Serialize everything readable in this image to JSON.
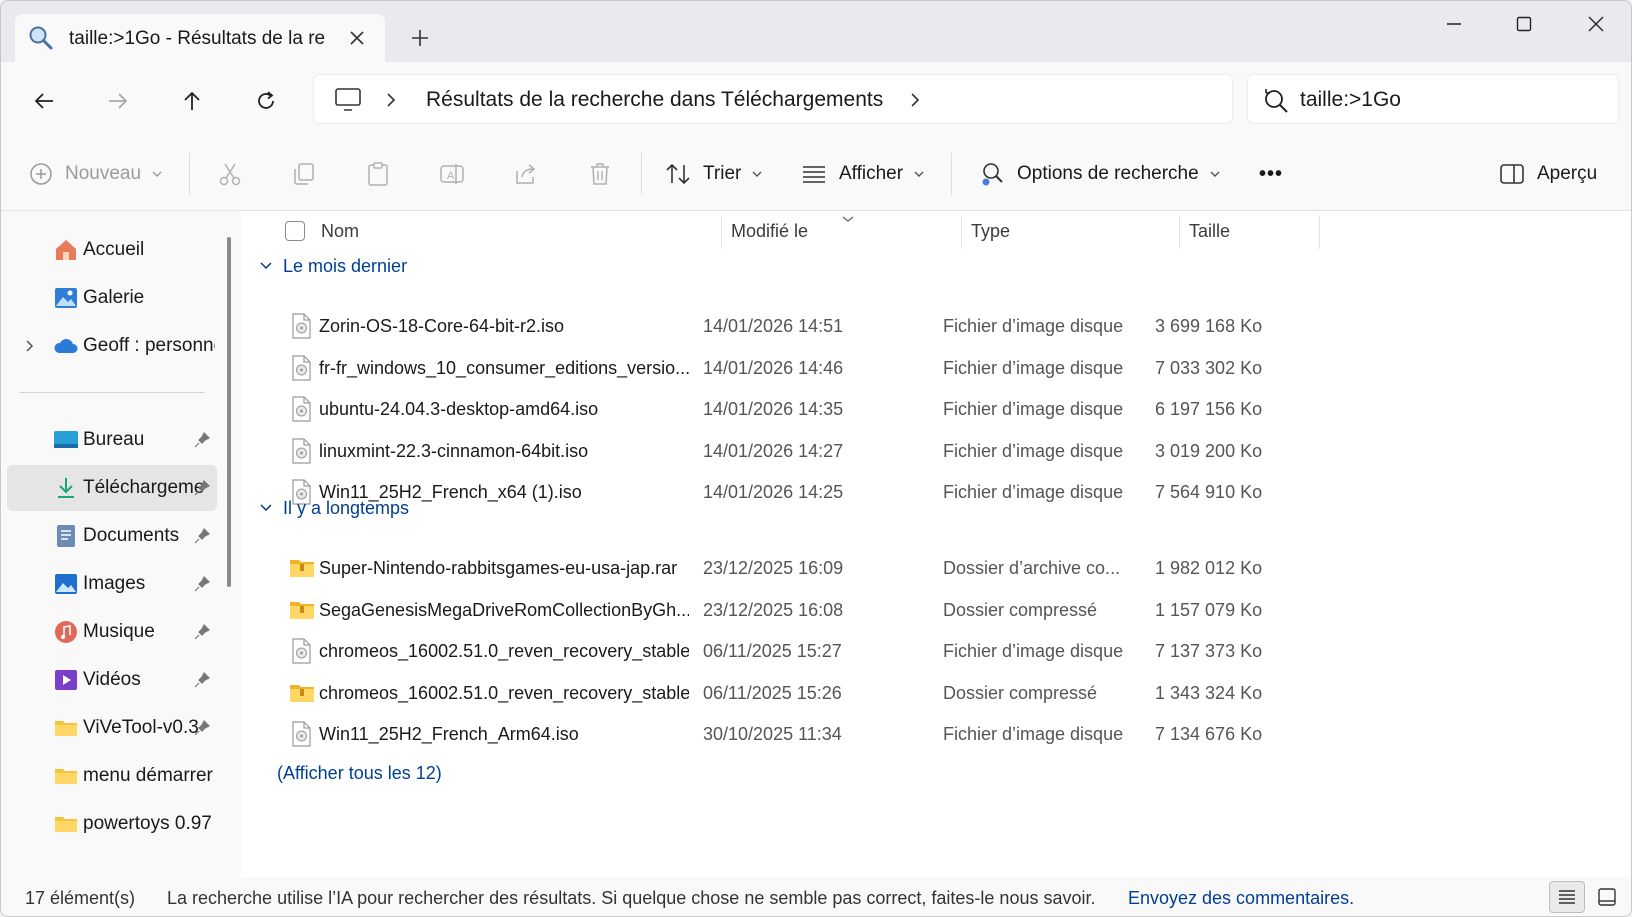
{
  "tab": {
    "title": "taille:>1Go - Résultats de la re"
  },
  "address": {
    "path": "Résultats de la recherche dans Téléchargements"
  },
  "search": {
    "query": "taille:>1Go"
  },
  "toolbar": {
    "new_label": "Nouveau",
    "sort_label": "Trier",
    "view_label": "Afficher",
    "search_options_label": "Options de recherche",
    "more_label": "•••",
    "preview_label": "Aperçu"
  },
  "sidebar": {
    "items": [
      {
        "label": "Accueil",
        "icon": "home-icon"
      },
      {
        "label": "Galerie",
        "icon": "gallery-icon"
      },
      {
        "label": "Geoff : personne",
        "icon": "cloud-icon"
      },
      {
        "label": "Bureau",
        "icon": "desktop-icon"
      },
      {
        "label": "Téléchargeme",
        "icon": "download-icon"
      },
      {
        "label": "Documents",
        "icon": "documents-icon"
      },
      {
        "label": "Images",
        "icon": "images-icon"
      },
      {
        "label": "Musique",
        "icon": "music-icon"
      },
      {
        "label": "Vidéos",
        "icon": "videos-icon"
      },
      {
        "label": "ViVeTool-v0.3",
        "icon": "folder-icon"
      },
      {
        "label": "menu démarrer",
        "icon": "folder-icon"
      },
      {
        "label": "powertoys 0.97",
        "icon": "folder-icon"
      }
    ]
  },
  "columns": {
    "name": "Nom",
    "modified": "Modifié le",
    "type": "Type",
    "size": "Taille"
  },
  "groups": [
    {
      "label": "Le mois dernier",
      "files": [
        {
          "name": "Zorin-OS-18-Core-64-bit-r2.iso",
          "date": "14/01/2026 14:51",
          "type": "Fichier d’image disque",
          "size": "3 699 168 Ko",
          "icon": "disc-image-icon"
        },
        {
          "name": "fr-fr_windows_10_consumer_editions_versio...",
          "date": "14/01/2026 14:46",
          "type": "Fichier d’image disque",
          "size": "7 033 302 Ko",
          "icon": "disc-image-icon"
        },
        {
          "name": "ubuntu-24.04.3-desktop-amd64.iso",
          "date": "14/01/2026 14:35",
          "type": "Fichier d’image disque",
          "size": "6 197 156 Ko",
          "icon": "disc-image-icon"
        },
        {
          "name": "linuxmint-22.3-cinnamon-64bit.iso",
          "date": "14/01/2026 14:27",
          "type": "Fichier d’image disque",
          "size": "3 019 200 Ko",
          "icon": "disc-image-icon"
        },
        {
          "name": "Win11_25H2_French_x64 (1).iso",
          "date": "14/01/2026 14:25",
          "type": "Fichier d’image disque",
          "size": "7 564 910 Ko",
          "icon": "disc-image-icon"
        }
      ]
    },
    {
      "label": "Il y a longtemps",
      "files": [
        {
          "name": "Super-Nintendo-rabbitsgames-eu-usa-jap.rar",
          "date": "23/12/2025 16:09",
          "type": "Dossier d’archive co...",
          "size": "1 982 012 Ko",
          "icon": "archive-folder-icon"
        },
        {
          "name": "SegaGenesisMegaDriveRomCollectionByGh...",
          "date": "23/12/2025 16:08",
          "type": "Dossier compressé",
          "size": "1 157 079 Ko",
          "icon": "archive-folder-icon"
        },
        {
          "name": "chromeos_16002.51.0_reven_recovery_stable...",
          "date": "06/11/2025 15:27",
          "type": "Fichier d’image disque",
          "size": "7 137 373 Ko",
          "icon": "disc-image-icon"
        },
        {
          "name": "chromeos_16002.51.0_reven_recovery_stable...",
          "date": "06/11/2025 15:26",
          "type": "Dossier compressé",
          "size": "1 343 324 Ko",
          "icon": "archive-folder-icon"
        },
        {
          "name": "Win11_25H2_French_Arm64.iso",
          "date": "30/10/2025 11:34",
          "type": "Fichier d’image disque",
          "size": "7 134 676 Ko",
          "icon": "disc-image-icon"
        }
      ]
    }
  ],
  "show_all_label": "(Afficher tous les 12)",
  "status": {
    "count": "17 élément(s)",
    "message": "La recherche utilise l’IA pour rechercher des résultats. Si quelque chose ne semble pas correct, faites-le nous savoir.",
    "feedback_link": "Envoyez des commentaires."
  },
  "colors": {
    "accent": "#003e92",
    "selected": "#e5e5e5",
    "folder": "#f5c441"
  }
}
